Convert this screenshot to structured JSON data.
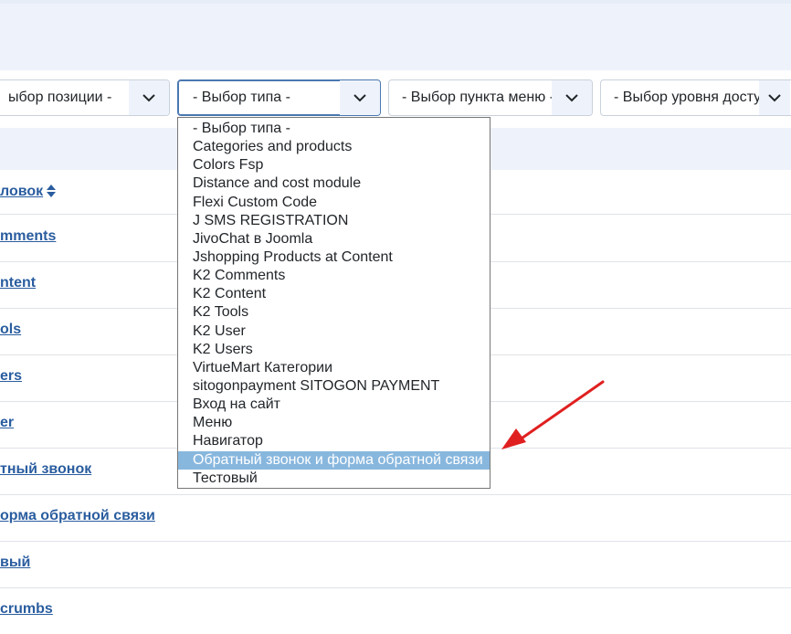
{
  "filters": [
    {
      "label": "ыбор позиции -"
    },
    {
      "label": "- Выбор типа -"
    },
    {
      "label": "- Выбор пункта меню -"
    },
    {
      "label": "- Выбор уровня доступа -"
    }
  ],
  "table": {
    "header_label": "ловок",
    "rows": [
      {
        "label": "mments"
      },
      {
        "label": "ntent"
      },
      {
        "label": "ols"
      },
      {
        "label": "ers"
      },
      {
        "label": "er"
      },
      {
        "label": "тный звонок"
      },
      {
        "label": "орма обратной связи"
      },
      {
        "label": "вый"
      },
      {
        "label": "crumbs"
      }
    ]
  },
  "type_dropdown": {
    "selected_index": 18,
    "options": [
      "- Выбор типа -",
      "Categories and products",
      "Colors Fsp",
      "Distance and cost module",
      "Flexi Custom Code",
      "J SMS REGISTRATION",
      "JivoChat в Joomla",
      "Jshopping Products at Content",
      "K2 Comments",
      "K2 Content",
      "K2 Tools",
      "K2 User",
      "K2 Users",
      "VirtueMart Категории",
      "sitogonpayment SITOGON PAYMENT",
      "Вход на сайт",
      "Меню",
      "Навигатор",
      "Обратный звонок и форма обратной связи",
      "Тестовый"
    ]
  },
  "colors": {
    "link": "#2a5d9f",
    "highlight": "#88b7de",
    "arrow": "#e02020"
  },
  "icons": {
    "filter_chevron": "chevron-down-icon",
    "sort": "sort-icon",
    "annotation": "red-arrow-icon"
  }
}
